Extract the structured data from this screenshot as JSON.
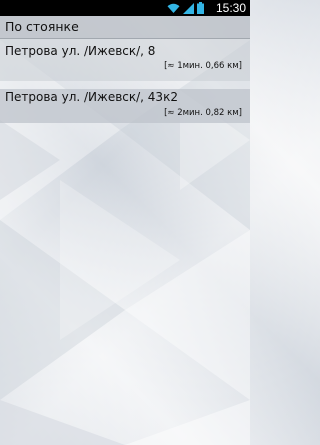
{
  "status_bar": {
    "time": "15:30",
    "icons": [
      "wifi-icon",
      "signal-icon",
      "battery-icon"
    ]
  },
  "header": {
    "title": "По стоянке"
  },
  "stops": [
    {
      "name": "Петрова ул. /Ижевск/, 8",
      "eta": "[≈ 1мин. 0,66 км]"
    },
    {
      "name": "Петрова ул. /Ижевск/, 43к2",
      "eta": "[≈ 2мин. 0,82 км]"
    }
  ]
}
